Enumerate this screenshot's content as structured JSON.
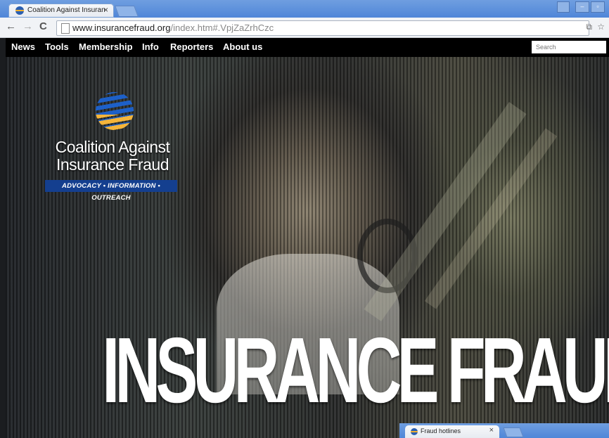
{
  "browser": {
    "tab_title": "Coalition Against Insuranc",
    "tab_close": "×",
    "back": "←",
    "forward": "→",
    "reload": "C",
    "url_host": "www.insurancefraud.org",
    "url_path": "/index.htm#.VpjZaZrhCzc",
    "win_min": "–",
    "win_max": "▫",
    "translate": "⧉",
    "star": "☆"
  },
  "nav": {
    "items": [
      "News",
      "Tools",
      "Membership",
      "Info",
      "Reporters",
      "About us"
    ],
    "search_placeholder": "Search"
  },
  "logo": {
    "line1": "Coalition Against",
    "line2": "Insurance Fraud",
    "tagline": "ADVOCACY • INFORMATION • OUTREACH"
  },
  "hero": {
    "headline": "INSURANCE FRAUD"
  },
  "window2": {
    "tab_title": "Fraud hotlines",
    "tab_close": "×"
  },
  "colors": {
    "chrome_blue": "#4f86d8",
    "nav_bg": "#000000",
    "logo_blue": "#1d60c8",
    "logo_gold": "#f4b43a",
    "tagline_bg": "#143f8f"
  }
}
